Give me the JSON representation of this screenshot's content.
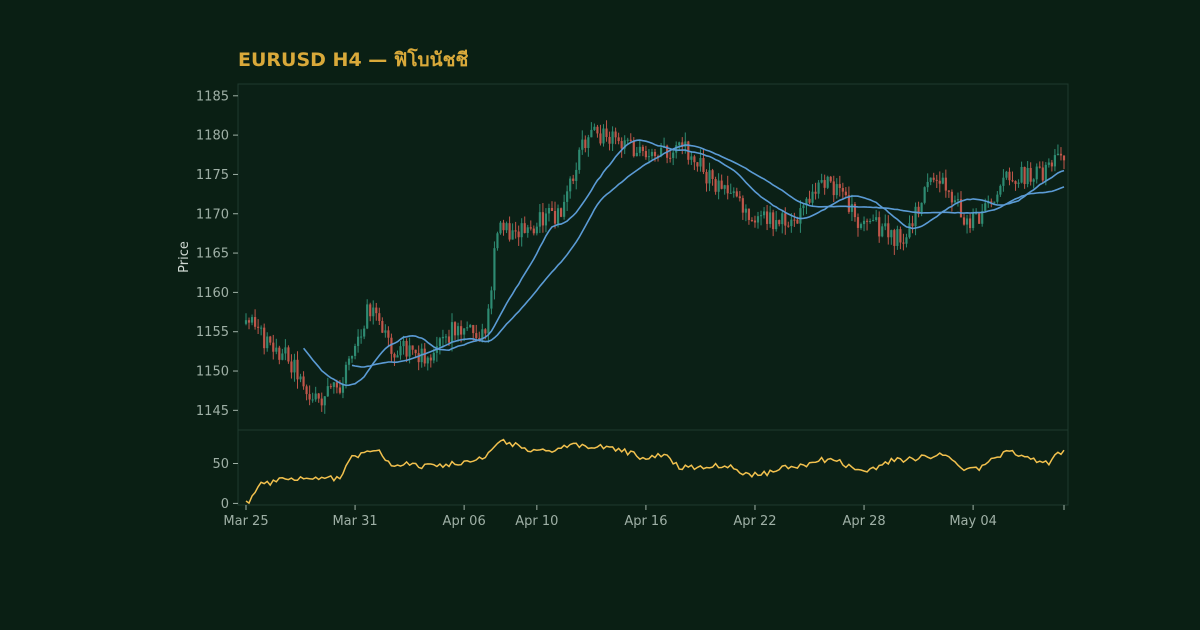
{
  "chart_data": {
    "type": "candlestick",
    "title": "EURUSD H4 — ฟิโบนัชชี",
    "ylabel": "Price",
    "colors": {
      "background": "#0a1f14",
      "panel": "#0b2016",
      "title": "#d9a93a",
      "up": "#2e8b72",
      "down": "#c0564a",
      "ma": "#5b9bd5",
      "oscillator": "#f2c14e",
      "frame": "#1f3a2e"
    },
    "price_panel": {
      "ylim": [
        1142.5,
        1186.5
      ],
      "yticks": [
        1145,
        1150,
        1155,
        1160,
        1165,
        1170,
        1175,
        1180,
        1185
      ]
    },
    "oscillator_panel": {
      "ylim": [
        -2,
        92
      ],
      "yticks": [
        0,
        50
      ]
    },
    "x_axis": {
      "type": "date",
      "range": [
        "2025-03-25",
        "2025-05-09"
      ],
      "ticks": [
        {
          "date": "2025-03-25",
          "label": "Mar 25"
        },
        {
          "date": "2025-03-31",
          "label": "Mar 31"
        },
        {
          "date": "2025-04-06",
          "label": "Apr 06"
        },
        {
          "date": "2025-04-10",
          "label": "Apr 10"
        },
        {
          "date": "2025-04-16",
          "label": "Apr 16"
        },
        {
          "date": "2025-04-22",
          "label": "Apr 22"
        },
        {
          "date": "2025-04-28",
          "label": "Apr 28"
        },
        {
          "date": "2025-05-04",
          "label": "May 04"
        }
      ]
    },
    "anchors": [
      [
        "2025-03-25",
        1156
      ],
      [
        "2025-03-27",
        1152
      ],
      [
        "2025-03-29",
        1146
      ],
      [
        "2025-03-30",
        1148
      ],
      [
        "2025-04-01",
        1158
      ],
      [
        "2025-04-02",
        1153
      ],
      [
        "2025-04-04",
        1152
      ],
      [
        "2025-04-06",
        1156
      ],
      [
        "2025-04-07",
        1155
      ],
      [
        "2025-04-08",
        1168
      ],
      [
        "2025-04-09",
        1168
      ],
      [
        "2025-04-11",
        1170
      ],
      [
        "2025-04-13",
        1180
      ],
      [
        "2025-04-16",
        1178
      ],
      [
        "2025-04-18",
        1178
      ],
      [
        "2025-04-20",
        1174
      ],
      [
        "2025-04-22",
        1169
      ],
      [
        "2025-04-24",
        1169
      ],
      [
        "2025-04-26",
        1174
      ],
      [
        "2025-04-28",
        1169
      ],
      [
        "2025-04-30",
        1167
      ],
      [
        "2025-05-02",
        1174
      ],
      [
        "2025-05-04",
        1169
      ],
      [
        "2025-05-06",
        1175
      ],
      [
        "2025-05-08",
        1175
      ],
      [
        "2025-05-09",
        1178
      ]
    ],
    "osc_anchors": [
      [
        "2025-03-25",
        0
      ],
      [
        "2025-03-26",
        25
      ],
      [
        "2025-03-27",
        30
      ],
      [
        "2025-03-29",
        30
      ],
      [
        "2025-03-30",
        32
      ],
      [
        "2025-03-31",
        60
      ],
      [
        "2025-04-01",
        68
      ],
      [
        "2025-04-02",
        50
      ],
      [
        "2025-04-04",
        47
      ],
      [
        "2025-04-06",
        50
      ],
      [
        "2025-04-07",
        55
      ],
      [
        "2025-04-08",
        78
      ],
      [
        "2025-04-10",
        65
      ],
      [
        "2025-04-12",
        72
      ],
      [
        "2025-04-14",
        70
      ],
      [
        "2025-04-16",
        58
      ],
      [
        "2025-04-17",
        60
      ],
      [
        "2025-04-18",
        45
      ],
      [
        "2025-04-20",
        48
      ],
      [
        "2025-04-22",
        36
      ],
      [
        "2025-04-24",
        45
      ],
      [
        "2025-04-26",
        55
      ],
      [
        "2025-04-28",
        42
      ],
      [
        "2025-04-30",
        55
      ],
      [
        "2025-05-02",
        60
      ],
      [
        "2025-05-04",
        42
      ],
      [
        "2025-05-06",
        65
      ],
      [
        "2025-05-08",
        50
      ],
      [
        "2025-05-09",
        65
      ]
    ]
  }
}
